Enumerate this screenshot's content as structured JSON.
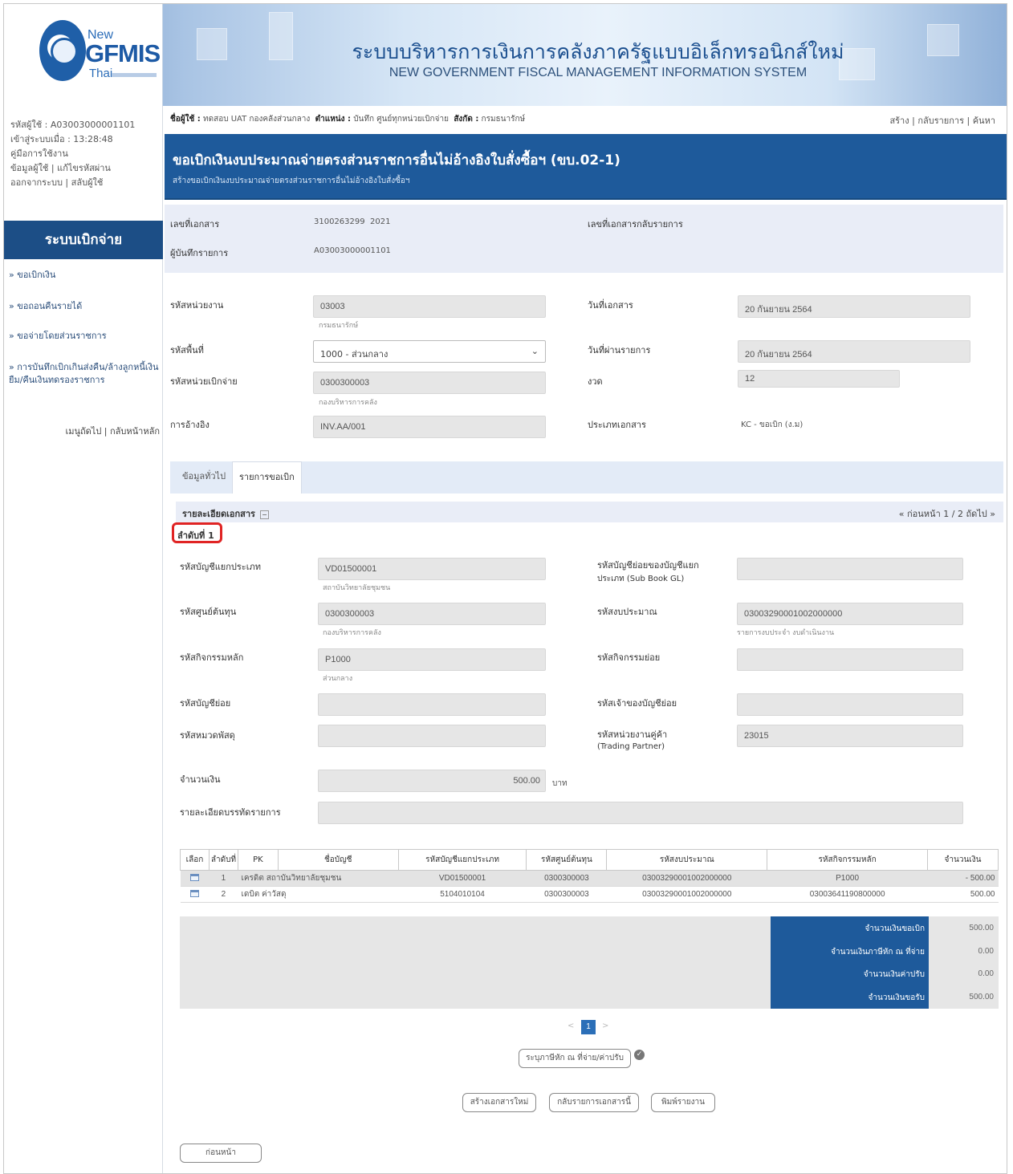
{
  "header": {
    "logo": {
      "new": "New",
      "gfmis": "GFMIS",
      "thai": "Thai"
    },
    "title_th": "ระบบบริหารการเงินการคลังภาครัฐแบบอิเล็กทรอนิกส์ใหม่",
    "title_en": "NEW GOVERNMENT FISCAL MANAGEMENT INFORMATION SYSTEM"
  },
  "sidebar": {
    "user_code": "รหัสผู้ใช้ : A03003000001101",
    "login_time": "เข้าสู่ระบบเมื่อ : 13:28:48",
    "manual": "คู่มือการใช้งาน",
    "user_info": "ข้อมูลผู้ใช้",
    "change_password": "แก้ไขรหัสผ่าน",
    "logout": "ออกจากระบบ",
    "switch_user": "สลับผู้ใช้",
    "section_title": "ระบบเบิกจ่าย",
    "items": [
      {
        "label": "» ขอเบิกเงิน"
      },
      {
        "label": "» ขอถอนคืนรายได้"
      },
      {
        "label": "» ขอจ่ายโดยส่วนราชการ"
      },
      {
        "label": "» การบันทึกเบิกเกินส่งคืน/ล้างลูกหนี้เงินยืม/คืนเงินทดรองราชการ"
      }
    ],
    "next_menu": "เมนูถัดไป",
    "home": "กลับหน้าหลัก"
  },
  "userbar": {
    "user_label": "ชื่อผู้ใช้ :",
    "user_value": "ทดสอบ UAT กองคลังส่วนกลาง",
    "position_label": "ตำแหน่ง :",
    "position_value": "บันทึก ศูนย์ทุกหน่วยเบิกจ่าย",
    "affiliation_label": "สังกัด :",
    "affiliation_value": "กรมธนารักษ์",
    "links": {
      "create": "สร้าง",
      "back": "กลับรายการ",
      "search": "ค้นหา"
    }
  },
  "document": {
    "title": "ขอเบิกเงินงบประมาณจ่ายตรงส่วนราชการอื่นไม่อ้างอิงใบสั่งซื้อฯ (ขบ.02-1)",
    "subtitle": "สร้างขอเบิกเงินงบประมาณจ่ายตรงส่วนราชการอื่นไม่อ้างอิงใบสั่งซื้อฯ",
    "doc_no_label": "เลขที่เอกสาร",
    "doc_no": "3100263299",
    "doc_year": "2021",
    "reverse_doc_label": "เลขที่เอกสารกลับรายการ",
    "recorder_label": "ผู้บันทึกรายการ",
    "recorder": "A03003000001101"
  },
  "form": {
    "agency_code_label": "รหัสหน่วยงาน",
    "agency_code": "03003",
    "agency_name": "กรมธนารักษ์",
    "doc_date_label": "วันที่เอกสาร",
    "doc_date": "20 กันยายน 2564",
    "area_code_label": "รหัสพื้นที่",
    "area_code": "1000 - ส่วนกลาง",
    "posting_date_label": "วันที่ผ่านรายการ",
    "posting_date": "20 กันยายน 2564",
    "disb_unit_label": "รหัสหน่วยเบิกจ่าย",
    "disb_unit": "0300300003",
    "disb_unit_name": "กองบริหารการคลัง",
    "period_label": "งวด",
    "period": "12",
    "reference_label": "การอ้างอิง",
    "reference": "INV.AA/001",
    "doc_type_label": "ประเภทเอกสาร",
    "doc_type": "KC - ขอเบิก (ง.ม)"
  },
  "tabs": [
    {
      "label": "ข้อมูลทั่วไป"
    },
    {
      "label": "รายการขอเบิก"
    }
  ],
  "detail": {
    "section_label": "รายละเอียดเอกสาร",
    "pager": "« ก่อนหน้า 1 / 2 ถัดไป »",
    "seq_label": "ลำดับที่ 1",
    "gl_label": "รหัสบัญชีแยกประเภท",
    "gl": "VD01500001",
    "gl_name": "สถาบันวิทยาลัยชุมชน",
    "subbook_label_1": "รหัสบัญชีย่อยของบัญชีแยก",
    "subbook_label_2": "ประเภท (Sub Book GL)",
    "subbook": "",
    "cost_center_label": "รหัสศูนย์ต้นทุน",
    "cost_center": "0300300003",
    "cost_center_name": "กองบริหารการคลัง",
    "budget_label": "รหัสงบประมาณ",
    "budget": "03003290001002000000",
    "budget_name": "รายการงบประจำ งบดำเนินงาน",
    "main_activity_label": "รหัสกิจกรรมหลัก",
    "main_activity": "P1000",
    "main_activity_name": "ส่วนกลาง",
    "sub_activity_label": "รหัสกิจกรรมย่อย",
    "sub_activity": "",
    "sub_account_label": "รหัสบัญชีย่อย",
    "sub_account": "",
    "sub_account_owner_label": "รหัสเจ้าของบัญชีย่อย",
    "sub_account_owner": "",
    "inventory_label": "รหัสหมวดพัสดุ",
    "inventory": "",
    "trading_partner_label_1": "รหัสหน่วยงานคู่ค้า",
    "trading_partner_label_2": "(Trading Partner)",
    "trading_partner": "23015",
    "amount_label": "จำนวนเงิน",
    "amount": "500.00",
    "currency": "บาท",
    "line_desc_label": "รายละเอียดบรรทัดรายการ",
    "line_desc": ""
  },
  "table": {
    "headers": [
      "เลือก",
      "ลำดับที่",
      "PK",
      "ชื่อบัญชี",
      "รหัสบัญชีแยกประเภท",
      "รหัสศูนย์ต้นทุน",
      "รหัสงบประมาณ",
      "รหัสกิจกรรมหลัก",
      "จำนวนเงิน"
    ],
    "rows": [
      {
        "seq": "1",
        "pk": "เครดิต",
        "name": "สถาบันวิทยาลัยชุมชน",
        "gl": "VD01500001",
        "cc": "0300300003",
        "budget": "03003290001002000000",
        "activity": "P1000",
        "amount": "- 500.00"
      },
      {
        "seq": "2",
        "pk": "เดบิต",
        "name": "ค่าวัสดุ",
        "gl": "5104010104",
        "cc": "0300300003",
        "budget": "03003290001002000000",
        "activity": "03003641190800000",
        "amount": "500.00"
      }
    ],
    "summary": [
      {
        "label": "จำนวนเงินขอเบิก",
        "value": "500.00"
      },
      {
        "label": "จำนวนเงินภาษีหัก ณ ที่จ่าย",
        "value": "0.00"
      },
      {
        "label": "จำนวนเงินค่าปรับ",
        "value": "0.00"
      },
      {
        "label": "จำนวนเงินขอรับ",
        "value": "500.00"
      }
    ]
  },
  "pagination": {
    "current": "1",
    "prev": "<",
    "next": ">"
  },
  "buttons": {
    "withholding": "ระบุภาษีหัก ณ ที่จ่าย/ค่าปรับ",
    "new_doc": "สร้างเอกสารใหม่",
    "reverse": "กลับรายการเอกสารนี้",
    "print": "พิมพ์รายงาน",
    "back": "ก่อนหน้า"
  },
  "colors": {
    "primary": "#1e5a9b",
    "highlight": "#e02424",
    "panel": "#e9edf7"
  }
}
